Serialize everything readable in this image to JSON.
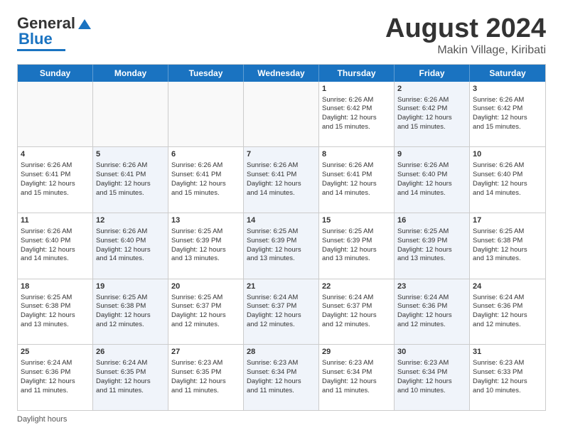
{
  "logo": {
    "part1": "General",
    "part2": "Blue"
  },
  "title": "August 2024",
  "subtitle": "Makin Village, Kiribati",
  "days": [
    "Sunday",
    "Monday",
    "Tuesday",
    "Wednesday",
    "Thursday",
    "Friday",
    "Saturday"
  ],
  "footer_label": "Daylight hours",
  "rows": [
    [
      {
        "day": "",
        "info": "",
        "shaded": false,
        "empty": true
      },
      {
        "day": "",
        "info": "",
        "shaded": false,
        "empty": true
      },
      {
        "day": "",
        "info": "",
        "shaded": false,
        "empty": true
      },
      {
        "day": "",
        "info": "",
        "shaded": false,
        "empty": true
      },
      {
        "day": "1",
        "info": "Sunrise: 6:26 AM\nSunset: 6:42 PM\nDaylight: 12 hours\nand 15 minutes.",
        "shaded": false,
        "empty": false
      },
      {
        "day": "2",
        "info": "Sunrise: 6:26 AM\nSunset: 6:42 PM\nDaylight: 12 hours\nand 15 minutes.",
        "shaded": true,
        "empty": false
      },
      {
        "day": "3",
        "info": "Sunrise: 6:26 AM\nSunset: 6:42 PM\nDaylight: 12 hours\nand 15 minutes.",
        "shaded": false,
        "empty": false
      }
    ],
    [
      {
        "day": "4",
        "info": "Sunrise: 6:26 AM\nSunset: 6:41 PM\nDaylight: 12 hours\nand 15 minutes.",
        "shaded": false,
        "empty": false
      },
      {
        "day": "5",
        "info": "Sunrise: 6:26 AM\nSunset: 6:41 PM\nDaylight: 12 hours\nand 15 minutes.",
        "shaded": true,
        "empty": false
      },
      {
        "day": "6",
        "info": "Sunrise: 6:26 AM\nSunset: 6:41 PM\nDaylight: 12 hours\nand 15 minutes.",
        "shaded": false,
        "empty": false
      },
      {
        "day": "7",
        "info": "Sunrise: 6:26 AM\nSunset: 6:41 PM\nDaylight: 12 hours\nand 14 minutes.",
        "shaded": true,
        "empty": false
      },
      {
        "day": "8",
        "info": "Sunrise: 6:26 AM\nSunset: 6:41 PM\nDaylight: 12 hours\nand 14 minutes.",
        "shaded": false,
        "empty": false
      },
      {
        "day": "9",
        "info": "Sunrise: 6:26 AM\nSunset: 6:40 PM\nDaylight: 12 hours\nand 14 minutes.",
        "shaded": true,
        "empty": false
      },
      {
        "day": "10",
        "info": "Sunrise: 6:26 AM\nSunset: 6:40 PM\nDaylight: 12 hours\nand 14 minutes.",
        "shaded": false,
        "empty": false
      }
    ],
    [
      {
        "day": "11",
        "info": "Sunrise: 6:26 AM\nSunset: 6:40 PM\nDaylight: 12 hours\nand 14 minutes.",
        "shaded": false,
        "empty": false
      },
      {
        "day": "12",
        "info": "Sunrise: 6:26 AM\nSunset: 6:40 PM\nDaylight: 12 hours\nand 14 minutes.",
        "shaded": true,
        "empty": false
      },
      {
        "day": "13",
        "info": "Sunrise: 6:25 AM\nSunset: 6:39 PM\nDaylight: 12 hours\nand 13 minutes.",
        "shaded": false,
        "empty": false
      },
      {
        "day": "14",
        "info": "Sunrise: 6:25 AM\nSunset: 6:39 PM\nDaylight: 12 hours\nand 13 minutes.",
        "shaded": true,
        "empty": false
      },
      {
        "day": "15",
        "info": "Sunrise: 6:25 AM\nSunset: 6:39 PM\nDaylight: 12 hours\nand 13 minutes.",
        "shaded": false,
        "empty": false
      },
      {
        "day": "16",
        "info": "Sunrise: 6:25 AM\nSunset: 6:39 PM\nDaylight: 12 hours\nand 13 minutes.",
        "shaded": true,
        "empty": false
      },
      {
        "day": "17",
        "info": "Sunrise: 6:25 AM\nSunset: 6:38 PM\nDaylight: 12 hours\nand 13 minutes.",
        "shaded": false,
        "empty": false
      }
    ],
    [
      {
        "day": "18",
        "info": "Sunrise: 6:25 AM\nSunset: 6:38 PM\nDaylight: 12 hours\nand 13 minutes.",
        "shaded": false,
        "empty": false
      },
      {
        "day": "19",
        "info": "Sunrise: 6:25 AM\nSunset: 6:38 PM\nDaylight: 12 hours\nand 12 minutes.",
        "shaded": true,
        "empty": false
      },
      {
        "day": "20",
        "info": "Sunrise: 6:25 AM\nSunset: 6:37 PM\nDaylight: 12 hours\nand 12 minutes.",
        "shaded": false,
        "empty": false
      },
      {
        "day": "21",
        "info": "Sunrise: 6:24 AM\nSunset: 6:37 PM\nDaylight: 12 hours\nand 12 minutes.",
        "shaded": true,
        "empty": false
      },
      {
        "day": "22",
        "info": "Sunrise: 6:24 AM\nSunset: 6:37 PM\nDaylight: 12 hours\nand 12 minutes.",
        "shaded": false,
        "empty": false
      },
      {
        "day": "23",
        "info": "Sunrise: 6:24 AM\nSunset: 6:36 PM\nDaylight: 12 hours\nand 12 minutes.",
        "shaded": true,
        "empty": false
      },
      {
        "day": "24",
        "info": "Sunrise: 6:24 AM\nSunset: 6:36 PM\nDaylight: 12 hours\nand 12 minutes.",
        "shaded": false,
        "empty": false
      }
    ],
    [
      {
        "day": "25",
        "info": "Sunrise: 6:24 AM\nSunset: 6:36 PM\nDaylight: 12 hours\nand 11 minutes.",
        "shaded": false,
        "empty": false
      },
      {
        "day": "26",
        "info": "Sunrise: 6:24 AM\nSunset: 6:35 PM\nDaylight: 12 hours\nand 11 minutes.",
        "shaded": true,
        "empty": false
      },
      {
        "day": "27",
        "info": "Sunrise: 6:23 AM\nSunset: 6:35 PM\nDaylight: 12 hours\nand 11 minutes.",
        "shaded": false,
        "empty": false
      },
      {
        "day": "28",
        "info": "Sunrise: 6:23 AM\nSunset: 6:34 PM\nDaylight: 12 hours\nand 11 minutes.",
        "shaded": true,
        "empty": false
      },
      {
        "day": "29",
        "info": "Sunrise: 6:23 AM\nSunset: 6:34 PM\nDaylight: 12 hours\nand 11 minutes.",
        "shaded": false,
        "empty": false
      },
      {
        "day": "30",
        "info": "Sunrise: 6:23 AM\nSunset: 6:34 PM\nDaylight: 12 hours\nand 10 minutes.",
        "shaded": true,
        "empty": false
      },
      {
        "day": "31",
        "info": "Sunrise: 6:23 AM\nSunset: 6:33 PM\nDaylight: 12 hours\nand 10 minutes.",
        "shaded": false,
        "empty": false
      }
    ]
  ]
}
